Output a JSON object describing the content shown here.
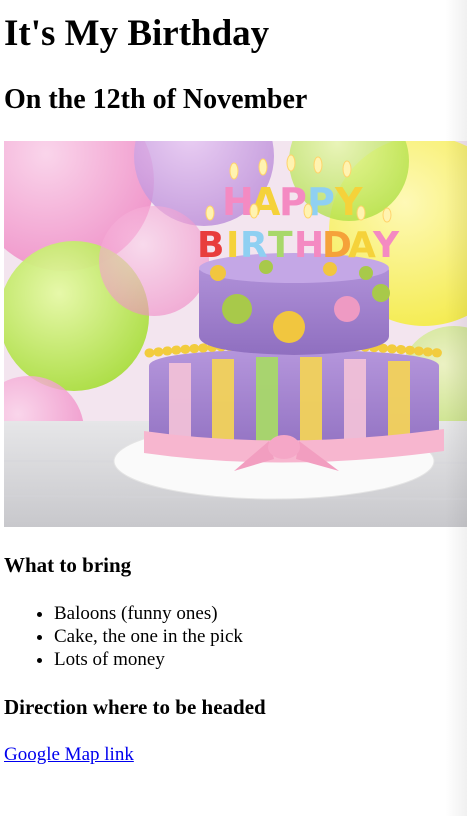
{
  "page": {
    "title": "It's My Birthday",
    "subtitle": "On the 12th of November"
  },
  "image": {
    "candle_letters": [
      "H",
      "A",
      "P",
      "P",
      "Y",
      "B",
      "I",
      "R",
      "T",
      "H",
      "D",
      "A",
      "Y"
    ]
  },
  "bring": {
    "heading": "What to bring",
    "items": [
      "Baloons (funny ones)",
      "Cake, the one in the pick",
      "Lots of money"
    ]
  },
  "directions": {
    "heading": "Direction where to be headed",
    "link_label": "Google Map link"
  }
}
